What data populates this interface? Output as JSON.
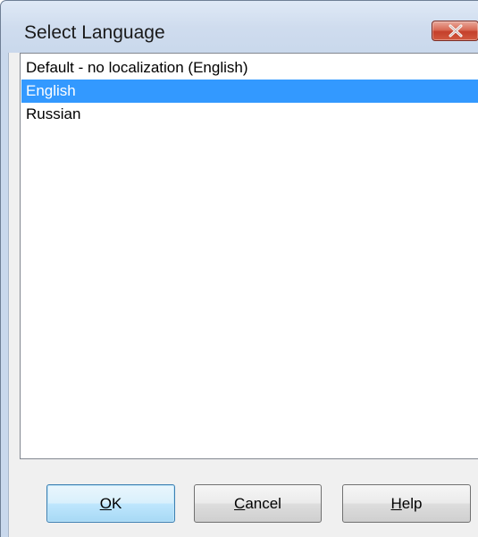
{
  "window": {
    "title": "Select Language"
  },
  "languages": {
    "items": [
      {
        "label": "Default - no localization (English)",
        "selected": false
      },
      {
        "label": "English",
        "selected": true
      },
      {
        "label": "Russian",
        "selected": false
      }
    ],
    "selected_index": 1
  },
  "buttons": {
    "ok": {
      "mnemonic": "O",
      "rest": "K"
    },
    "cancel": {
      "mnemonic": "C",
      "rest": "ancel"
    },
    "help": {
      "mnemonic": "H",
      "rest": "elp"
    }
  },
  "colors": {
    "selection": "#3399ff",
    "close_button": "#c4402b"
  },
  "icons": {
    "close": "close-x-icon"
  }
}
